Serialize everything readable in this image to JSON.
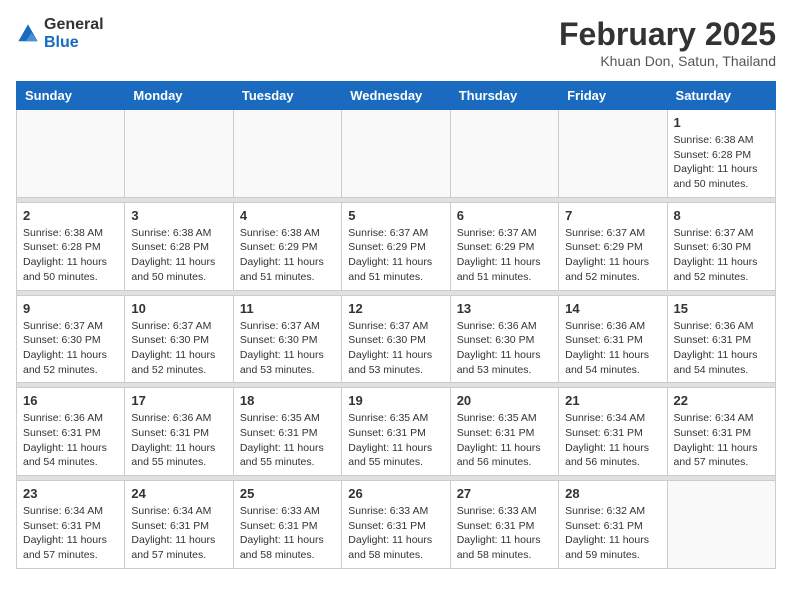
{
  "header": {
    "logo_general": "General",
    "logo_blue": "Blue",
    "month_year": "February 2025",
    "location": "Khuan Don, Satun, Thailand"
  },
  "weekdays": [
    "Sunday",
    "Monday",
    "Tuesday",
    "Wednesday",
    "Thursday",
    "Friday",
    "Saturday"
  ],
  "weeks": [
    [
      {
        "day": "",
        "info": ""
      },
      {
        "day": "",
        "info": ""
      },
      {
        "day": "",
        "info": ""
      },
      {
        "day": "",
        "info": ""
      },
      {
        "day": "",
        "info": ""
      },
      {
        "day": "",
        "info": ""
      },
      {
        "day": "1",
        "info": "Sunrise: 6:38 AM\nSunset: 6:28 PM\nDaylight: 11 hours\nand 50 minutes."
      }
    ],
    [
      {
        "day": "2",
        "info": "Sunrise: 6:38 AM\nSunset: 6:28 PM\nDaylight: 11 hours\nand 50 minutes."
      },
      {
        "day": "3",
        "info": "Sunrise: 6:38 AM\nSunset: 6:28 PM\nDaylight: 11 hours\nand 50 minutes."
      },
      {
        "day": "4",
        "info": "Sunrise: 6:38 AM\nSunset: 6:29 PM\nDaylight: 11 hours\nand 51 minutes."
      },
      {
        "day": "5",
        "info": "Sunrise: 6:37 AM\nSunset: 6:29 PM\nDaylight: 11 hours\nand 51 minutes."
      },
      {
        "day": "6",
        "info": "Sunrise: 6:37 AM\nSunset: 6:29 PM\nDaylight: 11 hours\nand 51 minutes."
      },
      {
        "day": "7",
        "info": "Sunrise: 6:37 AM\nSunset: 6:29 PM\nDaylight: 11 hours\nand 52 minutes."
      },
      {
        "day": "8",
        "info": "Sunrise: 6:37 AM\nSunset: 6:30 PM\nDaylight: 11 hours\nand 52 minutes."
      }
    ],
    [
      {
        "day": "9",
        "info": "Sunrise: 6:37 AM\nSunset: 6:30 PM\nDaylight: 11 hours\nand 52 minutes."
      },
      {
        "day": "10",
        "info": "Sunrise: 6:37 AM\nSunset: 6:30 PM\nDaylight: 11 hours\nand 52 minutes."
      },
      {
        "day": "11",
        "info": "Sunrise: 6:37 AM\nSunset: 6:30 PM\nDaylight: 11 hours\nand 53 minutes."
      },
      {
        "day": "12",
        "info": "Sunrise: 6:37 AM\nSunset: 6:30 PM\nDaylight: 11 hours\nand 53 minutes."
      },
      {
        "day": "13",
        "info": "Sunrise: 6:36 AM\nSunset: 6:30 PM\nDaylight: 11 hours\nand 53 minutes."
      },
      {
        "day": "14",
        "info": "Sunrise: 6:36 AM\nSunset: 6:31 PM\nDaylight: 11 hours\nand 54 minutes."
      },
      {
        "day": "15",
        "info": "Sunrise: 6:36 AM\nSunset: 6:31 PM\nDaylight: 11 hours\nand 54 minutes."
      }
    ],
    [
      {
        "day": "16",
        "info": "Sunrise: 6:36 AM\nSunset: 6:31 PM\nDaylight: 11 hours\nand 54 minutes."
      },
      {
        "day": "17",
        "info": "Sunrise: 6:36 AM\nSunset: 6:31 PM\nDaylight: 11 hours\nand 55 minutes."
      },
      {
        "day": "18",
        "info": "Sunrise: 6:35 AM\nSunset: 6:31 PM\nDaylight: 11 hours\nand 55 minutes."
      },
      {
        "day": "19",
        "info": "Sunrise: 6:35 AM\nSunset: 6:31 PM\nDaylight: 11 hours\nand 55 minutes."
      },
      {
        "day": "20",
        "info": "Sunrise: 6:35 AM\nSunset: 6:31 PM\nDaylight: 11 hours\nand 56 minutes."
      },
      {
        "day": "21",
        "info": "Sunrise: 6:34 AM\nSunset: 6:31 PM\nDaylight: 11 hours\nand 56 minutes."
      },
      {
        "day": "22",
        "info": "Sunrise: 6:34 AM\nSunset: 6:31 PM\nDaylight: 11 hours\nand 57 minutes."
      }
    ],
    [
      {
        "day": "23",
        "info": "Sunrise: 6:34 AM\nSunset: 6:31 PM\nDaylight: 11 hours\nand 57 minutes."
      },
      {
        "day": "24",
        "info": "Sunrise: 6:34 AM\nSunset: 6:31 PM\nDaylight: 11 hours\nand 57 minutes."
      },
      {
        "day": "25",
        "info": "Sunrise: 6:33 AM\nSunset: 6:31 PM\nDaylight: 11 hours\nand 58 minutes."
      },
      {
        "day": "26",
        "info": "Sunrise: 6:33 AM\nSunset: 6:31 PM\nDaylight: 11 hours\nand 58 minutes."
      },
      {
        "day": "27",
        "info": "Sunrise: 6:33 AM\nSunset: 6:31 PM\nDaylight: 11 hours\nand 58 minutes."
      },
      {
        "day": "28",
        "info": "Sunrise: 6:32 AM\nSunset: 6:31 PM\nDaylight: 11 hours\nand 59 minutes."
      },
      {
        "day": "",
        "info": ""
      }
    ]
  ]
}
